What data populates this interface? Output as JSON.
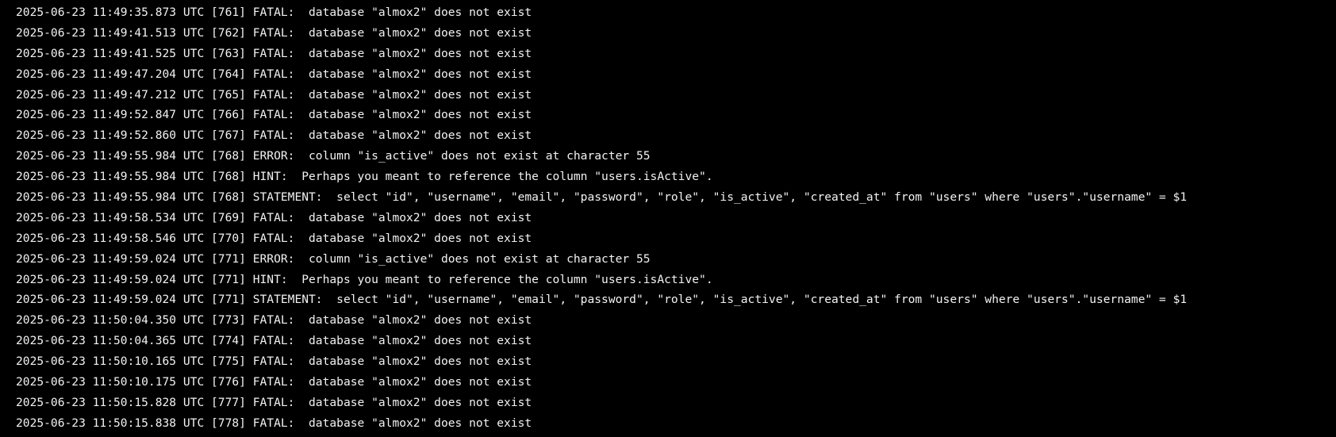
{
  "colors": {
    "background": "#000000",
    "text": "#f2f2f2"
  },
  "log_lines": [
    "2025-06-23 11:49:35.873 UTC [761] FATAL:  database \"almox2\" does not exist",
    "2025-06-23 11:49:41.513 UTC [762] FATAL:  database \"almox2\" does not exist",
    "2025-06-23 11:49:41.525 UTC [763] FATAL:  database \"almox2\" does not exist",
    "2025-06-23 11:49:47.204 UTC [764] FATAL:  database \"almox2\" does not exist",
    "2025-06-23 11:49:47.212 UTC [765] FATAL:  database \"almox2\" does not exist",
    "2025-06-23 11:49:52.847 UTC [766] FATAL:  database \"almox2\" does not exist",
    "2025-06-23 11:49:52.860 UTC [767] FATAL:  database \"almox2\" does not exist",
    "2025-06-23 11:49:55.984 UTC [768] ERROR:  column \"is_active\" does not exist at character 55",
    "2025-06-23 11:49:55.984 UTC [768] HINT:  Perhaps you meant to reference the column \"users.isActive\".",
    "2025-06-23 11:49:55.984 UTC [768] STATEMENT:  select \"id\", \"username\", \"email\", \"password\", \"role\", \"is_active\", \"created_at\" from \"users\" where \"users\".\"username\" = $1",
    "2025-06-23 11:49:58.534 UTC [769] FATAL:  database \"almox2\" does not exist",
    "2025-06-23 11:49:58.546 UTC [770] FATAL:  database \"almox2\" does not exist",
    "2025-06-23 11:49:59.024 UTC [771] ERROR:  column \"is_active\" does not exist at character 55",
    "2025-06-23 11:49:59.024 UTC [771] HINT:  Perhaps you meant to reference the column \"users.isActive\".",
    "2025-06-23 11:49:59.024 UTC [771] STATEMENT:  select \"id\", \"username\", \"email\", \"password\", \"role\", \"is_active\", \"created_at\" from \"users\" where \"users\".\"username\" = $1",
    "2025-06-23 11:50:04.350 UTC [773] FATAL:  database \"almox2\" does not exist",
    "2025-06-23 11:50:04.365 UTC [774] FATAL:  database \"almox2\" does not exist",
    "2025-06-23 11:50:10.165 UTC [775] FATAL:  database \"almox2\" does not exist",
    "2025-06-23 11:50:10.175 UTC [776] FATAL:  database \"almox2\" does not exist",
    "2025-06-23 11:50:15.828 UTC [777] FATAL:  database \"almox2\" does not exist",
    "2025-06-23 11:50:15.838 UTC [778] FATAL:  database \"almox2\" does not exist"
  ]
}
